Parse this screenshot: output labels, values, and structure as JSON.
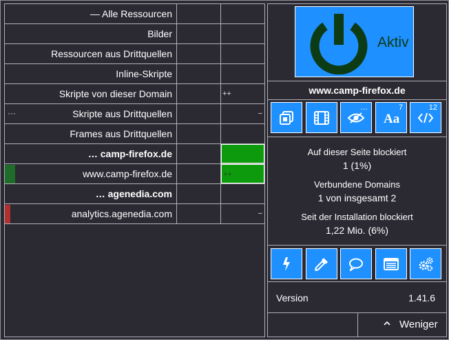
{
  "matrix": {
    "rows": [
      {
        "name": "— Alle Ressourcen",
        "bold": false,
        "dots": "",
        "c2": "",
        "c2minus": "",
        "green": false,
        "bar": ""
      },
      {
        "name": "Bilder",
        "bold": false,
        "dots": "",
        "c2": "",
        "c2minus": "",
        "green": false,
        "bar": ""
      },
      {
        "name": "Ressourcen aus Drittquellen",
        "bold": false,
        "dots": "",
        "c2": "",
        "c2minus": "",
        "green": false,
        "bar": ""
      },
      {
        "name": "Inline-Skripte",
        "bold": false,
        "dots": "",
        "c2": "",
        "c2minus": "",
        "green": false,
        "bar": ""
      },
      {
        "name": "Skripte von dieser Domain",
        "bold": false,
        "dots": "",
        "c2": "++",
        "c2minus": "",
        "green": false,
        "bar": ""
      },
      {
        "name": "Skripte aus Drittquellen",
        "bold": false,
        "dots": "···",
        "c2": "",
        "c2minus": "−",
        "green": false,
        "bar": ""
      },
      {
        "name": "Frames aus Drittquellen",
        "bold": false,
        "dots": "",
        "c2": "",
        "c2minus": "",
        "green": false,
        "bar": ""
      },
      {
        "name": "… camp-firefox.de",
        "bold": true,
        "dots": "",
        "c2": "",
        "c2minus": "",
        "green": true,
        "bar": ""
      },
      {
        "name": "www.camp-firefox.de",
        "bold": false,
        "dots": "",
        "c2": "++",
        "c2minus": "",
        "green": true,
        "bar": "#1e6b2a"
      },
      {
        "name": "… agenedia.com",
        "bold": true,
        "dots": "",
        "c2": "",
        "c2minus": "",
        "green": false,
        "bar": ""
      },
      {
        "name": "analytics.agenedia.com",
        "bold": false,
        "dots": "",
        "c2": "",
        "c2minus": "−",
        "green": false,
        "bar": "#b03030"
      }
    ]
  },
  "panel": {
    "power_state": "Aktiv",
    "hostname": "www.camp-firefox.de",
    "tools": [
      {
        "icon": "element-picker-icon",
        "badge": ""
      },
      {
        "icon": "film-icon",
        "badge": ""
      },
      {
        "icon": "eye-slash-icon",
        "badge": "…"
      },
      {
        "icon": "font-icon",
        "badge": "7"
      },
      {
        "icon": "code-icon",
        "badge": "12"
      }
    ],
    "stats": {
      "blocked_page_label": "Auf dieser Seite blockiert",
      "blocked_page_value": "1 (1%)",
      "domains_label": "Verbundene Domains",
      "domains_value": "1 von insgesamt 2",
      "blocked_total_label": "Seit der Installation blockiert",
      "blocked_total_value": "1,22 Mio. (6%)"
    },
    "actions": [
      {
        "icon": "lightning-icon"
      },
      {
        "icon": "eyedropper-icon"
      },
      {
        "icon": "speech-bubble-icon"
      },
      {
        "icon": "list-window-icon"
      },
      {
        "icon": "gears-icon"
      }
    ],
    "version_label": "Version",
    "version_value": "1.41.6",
    "less_label": "Weniger"
  },
  "colors": {
    "background": "#2b2a33",
    "accent": "#1e90ff",
    "allow_green": "#0d9b0d",
    "power_icon": "#0c3b14",
    "border": "#b0b0b8"
  },
  "chart_data": null
}
